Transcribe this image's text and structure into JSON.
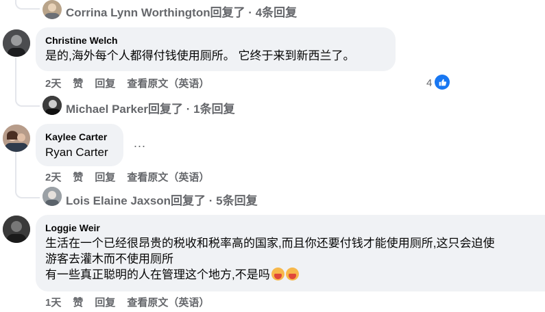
{
  "threads": {
    "t0": {
      "reply_summary": "Corrina Lynn Worthington回复了 · 4条回复"
    },
    "c1": {
      "author": "Christine Welch",
      "line1": "是的,海外每个人都得付钱使用厕所。 它终于来到新西兰了。",
      "time": "2天",
      "like": "赞",
      "reply": "回复",
      "see_original": "查看原文（英语）",
      "reaction_count": "4",
      "reply_summary": "Michael Parker回复了 · 1条回复"
    },
    "c2": {
      "author": "Kaylee Carter",
      "line1": "Ryan Carter",
      "more": "...",
      "time": "2天",
      "like": "赞",
      "reply": "回复",
      "see_original": "查看原文（英语）",
      "reply_summary": "Lois Elaine Jaxson回复了 · 5条回复"
    },
    "c3": {
      "author": "Loggie Weir",
      "line1": "生活在一个已经很昂贵的税收和税率高的国家,而且你还要付钱才能使用厕所,这只会迫使",
      "line2": "游客去灌木而不使用厕所",
      "line3": "有一些真正聪明的人在管理这个地方,不是吗",
      "time": "1天",
      "like": "赞",
      "reply": "回复",
      "see_original": "查看原文（英语）"
    }
  },
  "icons": {
    "reaction": "thumbs-up-icon",
    "emoji": "facepalm-emoji-icon"
  },
  "colors": {
    "bubble": "#f0f2f5",
    "secondary_text": "#65676b",
    "like_blue": "#1877f2"
  }
}
